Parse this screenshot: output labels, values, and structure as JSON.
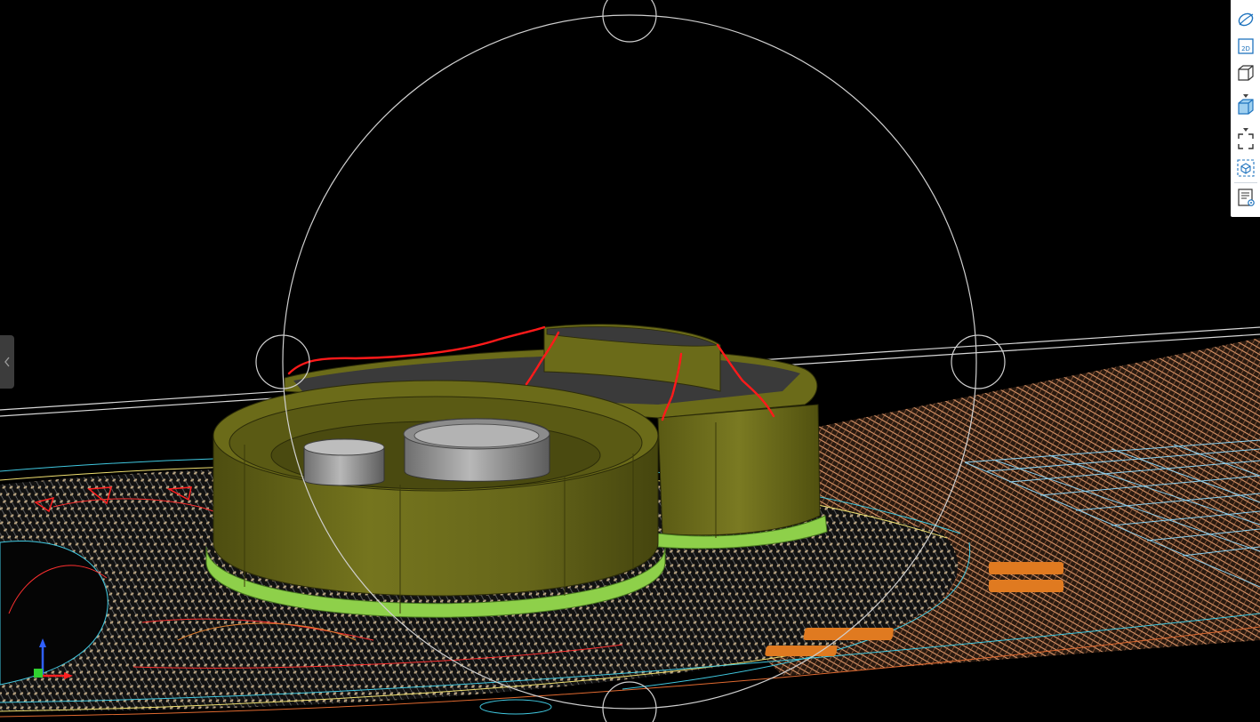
{
  "app": {
    "mode": "3D orbit view"
  },
  "toolbar": {
    "items": [
      {
        "id": "orbit",
        "icon": "orbit-icon"
      },
      {
        "id": "2d",
        "icon": "view-2d-icon",
        "label": "2D"
      },
      {
        "id": "3d-box",
        "icon": "box-outline-icon"
      },
      {
        "id": "shaded",
        "icon": "shaded-cube-icon"
      },
      {
        "id": "fullscreen",
        "icon": "fullscreen-icon"
      },
      {
        "id": "section",
        "icon": "section-box-icon"
      },
      {
        "id": "properties",
        "icon": "properties-icon"
      }
    ]
  },
  "colors": {
    "background": "#000000",
    "accent": "#1e73be",
    "model_olive": "#6b6b19",
    "model_base": "#8ed04a",
    "markup_red": "#ff1a1a",
    "hatch_orange": "#e8a070",
    "cad_cyan": "#40c8e0"
  }
}
